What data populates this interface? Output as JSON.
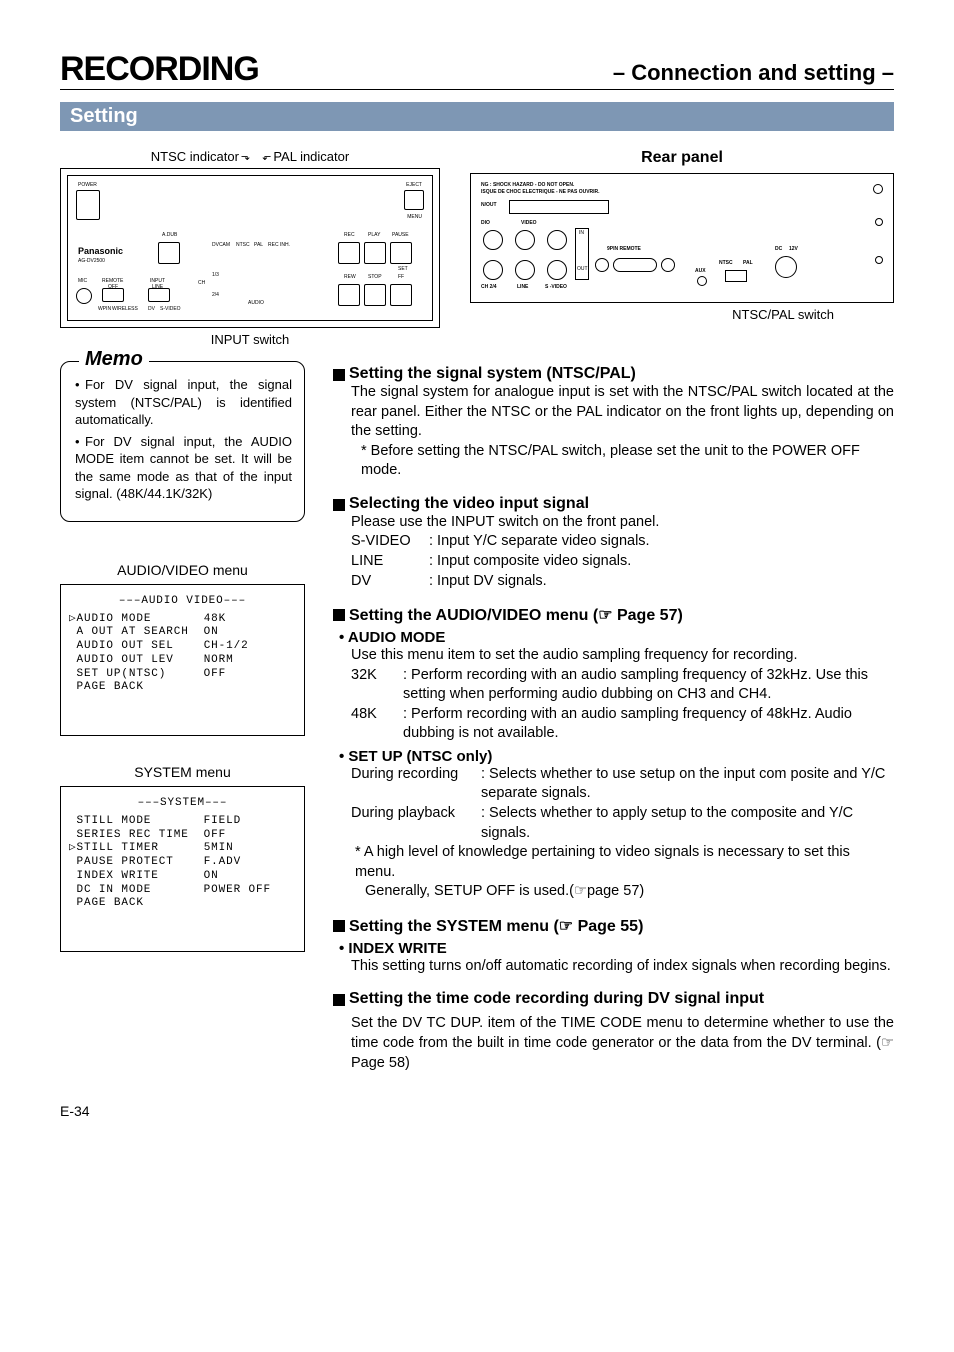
{
  "header": {
    "left": "RECORDING",
    "right": "– Connection and setting –"
  },
  "setting_bar": "Setting",
  "indicators": {
    "ntsc": "NTSC indicator",
    "pal": "PAL indicator"
  },
  "rear_title": "Rear panel",
  "callouts": {
    "input_switch": "INPUT switch",
    "ntsc_pal_switch": "NTSC/PAL switch"
  },
  "front_panel": {
    "brand": "Panasonic",
    "model": "AG-DV2500",
    "labels": [
      "POWER",
      "EJECT",
      "MENU",
      "A.DUB",
      "REC",
      "PLAY",
      "PAUSE",
      "REW",
      "STOP",
      "FF",
      "SET",
      "MIC",
      "REMOTE",
      "INPUT",
      "OFF",
      "LINE",
      "DV",
      "S-VIDEO",
      "WIRELESS",
      "WPIN",
      "CH",
      "AUDIO",
      "1/3",
      "2/4",
      "DVCAM",
      "NTSC",
      "PAL",
      "REC INH."
    ]
  },
  "rear_panel": {
    "warning1": "NG : SHOCK HAZARD - DO NOT OPEN.",
    "warning2": "ISQUE DE CHOC ELECTRIQUE - NE PAS OUVRIR.",
    "labels": [
      "N/OUT",
      "DIO",
      "VIDEO",
      "CH 2/4",
      "LINE",
      "S -VIDEO",
      "9PIN REMOTE",
      "AUX",
      "NTSC",
      "PAL",
      "IN",
      "OUT",
      "DC",
      "12V"
    ]
  },
  "memo": {
    "title": "Memo",
    "items": [
      "For DV signal input, the signal system (NTSC/PAL) is identified automatically.",
      "For DV signal input, the AUDIO MODE item cannot be set. It will be the same mode as that of the input signal. (48K/44.1K/32K)"
    ]
  },
  "av_menu": {
    "caption": "AUDIO/VIDEO menu",
    "header": "–––AUDIO VIDEO–––",
    "rows": [
      {
        "k": "▷AUDIO MODE",
        "v": "48K"
      },
      {
        "k": " A OUT AT SEARCH",
        "v": "ON"
      },
      {
        "k": " AUDIO OUT SEL",
        "v": "CH-1/2"
      },
      {
        "k": " AUDIO OUT LEV",
        "v": "NORM"
      },
      {
        "k": " SET UP(NTSC)",
        "v": "OFF"
      },
      {
        "k": " PAGE BACK",
        "v": ""
      }
    ]
  },
  "sys_menu": {
    "caption": "SYSTEM menu",
    "header": "–––SYSTEM–––",
    "rows": [
      {
        "k": " STILL MODE",
        "v": "FIELD"
      },
      {
        "k": " SERIES REC TIME",
        "v": "OFF"
      },
      {
        "k": "▷STILL TIMER",
        "v": "5MIN"
      },
      {
        "k": " PAUSE PROTECT",
        "v": "F.ADV"
      },
      {
        "k": " INDEX WRITE",
        "v": "ON"
      },
      {
        "k": " DC IN MODE",
        "v": "POWER OFF"
      },
      {
        "k": " PAGE BACK",
        "v": ""
      }
    ]
  },
  "sections": {
    "s1": {
      "title": "Setting the signal system (NTSC/PAL)",
      "body": "The signal system for analogue input is set with the NTSC/PAL switch located at the rear panel. Either the NTSC or the PAL indicator on the front lights up, depending on the setting.",
      "note": "* Before setting the NTSC/PAL switch, please set the unit to the POWER OFF mode."
    },
    "s2": {
      "title": "Selecting the video input signal",
      "body": "Please use the INPUT switch on the front panel.",
      "defs": [
        {
          "t": "S-VIDEO",
          "d": ": Input Y/C separate video signals."
        },
        {
          "t": "LINE",
          "d": ": Input composite video signals."
        },
        {
          "t": "DV",
          "d": ": Input DV signals."
        }
      ]
    },
    "s3": {
      "title": "Setting the AUDIO/VIDEO menu (☞ Page 57)",
      "audio_mode_label": "• AUDIO MODE",
      "audio_mode_body": "Use this menu item to set the audio sampling frequency for recording.",
      "audio_defs": [
        {
          "t": "32K",
          "d": ": Perform recording with an audio sampling frequency of 32kHz. Use this setting when performing audio dubbing on CH3 and CH4."
        },
        {
          "t": "48K",
          "d": ": Perform recording with an audio sampling frequency of 48kHz. Audio dubbing is not available."
        }
      ],
      "setup_label": "• SET UP (NTSC only)",
      "setup_defs": [
        {
          "t": "During recording",
          "d": ": Selects whether to use setup on the input com posite and Y/C separate signals."
        },
        {
          "t": "During playback",
          "d": ": Selects whether to apply setup to the composite and Y/C signals."
        }
      ],
      "setup_note": "* A high level of knowledge pertaining to video signals is necessary to set this menu.",
      "setup_note2": "Generally, SETUP OFF is used.(☞page 57)"
    },
    "s4": {
      "title": "Setting the SYSTEM menu (☞ Page 55)",
      "index_label": "• INDEX WRITE",
      "index_body": "This setting turns on/off automatic recording of index signals when recording begins."
    },
    "s5": {
      "title": "Setting the time code recording during DV signal input",
      "body": "Set the DV TC DUP. item of the TIME CODE menu to determine whether to use the time code from the built in time code generator  or the data from the DV terminal. (☞ Page 58)"
    }
  },
  "page_number": "E-34"
}
